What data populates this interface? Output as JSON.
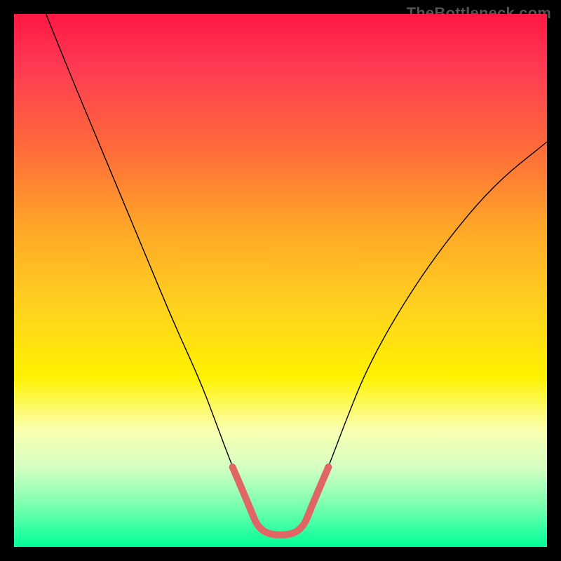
{
  "watermark": "TheBottleneck.com",
  "chart_data": {
    "type": "line",
    "title": "",
    "xlabel": "",
    "ylabel": "",
    "xlim": [
      0,
      100
    ],
    "ylim": [
      0,
      100
    ],
    "grid": false,
    "legend": false,
    "series": [
      {
        "name": "bottleneck-curve",
        "stroke": "#000000",
        "stroke_width": 1.4,
        "x": [
          6,
          10,
          15,
          20,
          25,
          30,
          35,
          38,
          41,
          44,
          46,
          50,
          54,
          56,
          59,
          62,
          66,
          72,
          80,
          90,
          100
        ],
        "values": [
          100,
          90,
          78,
          66,
          54,
          42,
          31,
          23,
          15,
          8,
          3,
          2,
          3,
          8,
          15,
          23,
          33,
          44,
          56,
          68,
          76
        ]
      },
      {
        "name": "highlight-band",
        "stroke": "#e06666",
        "stroke_width": 10,
        "linecap": "round",
        "x": [
          41,
          44,
          46,
          50,
          54,
          56,
          59
        ],
        "values": [
          15,
          8,
          3,
          2,
          3,
          8,
          15
        ]
      }
    ]
  }
}
